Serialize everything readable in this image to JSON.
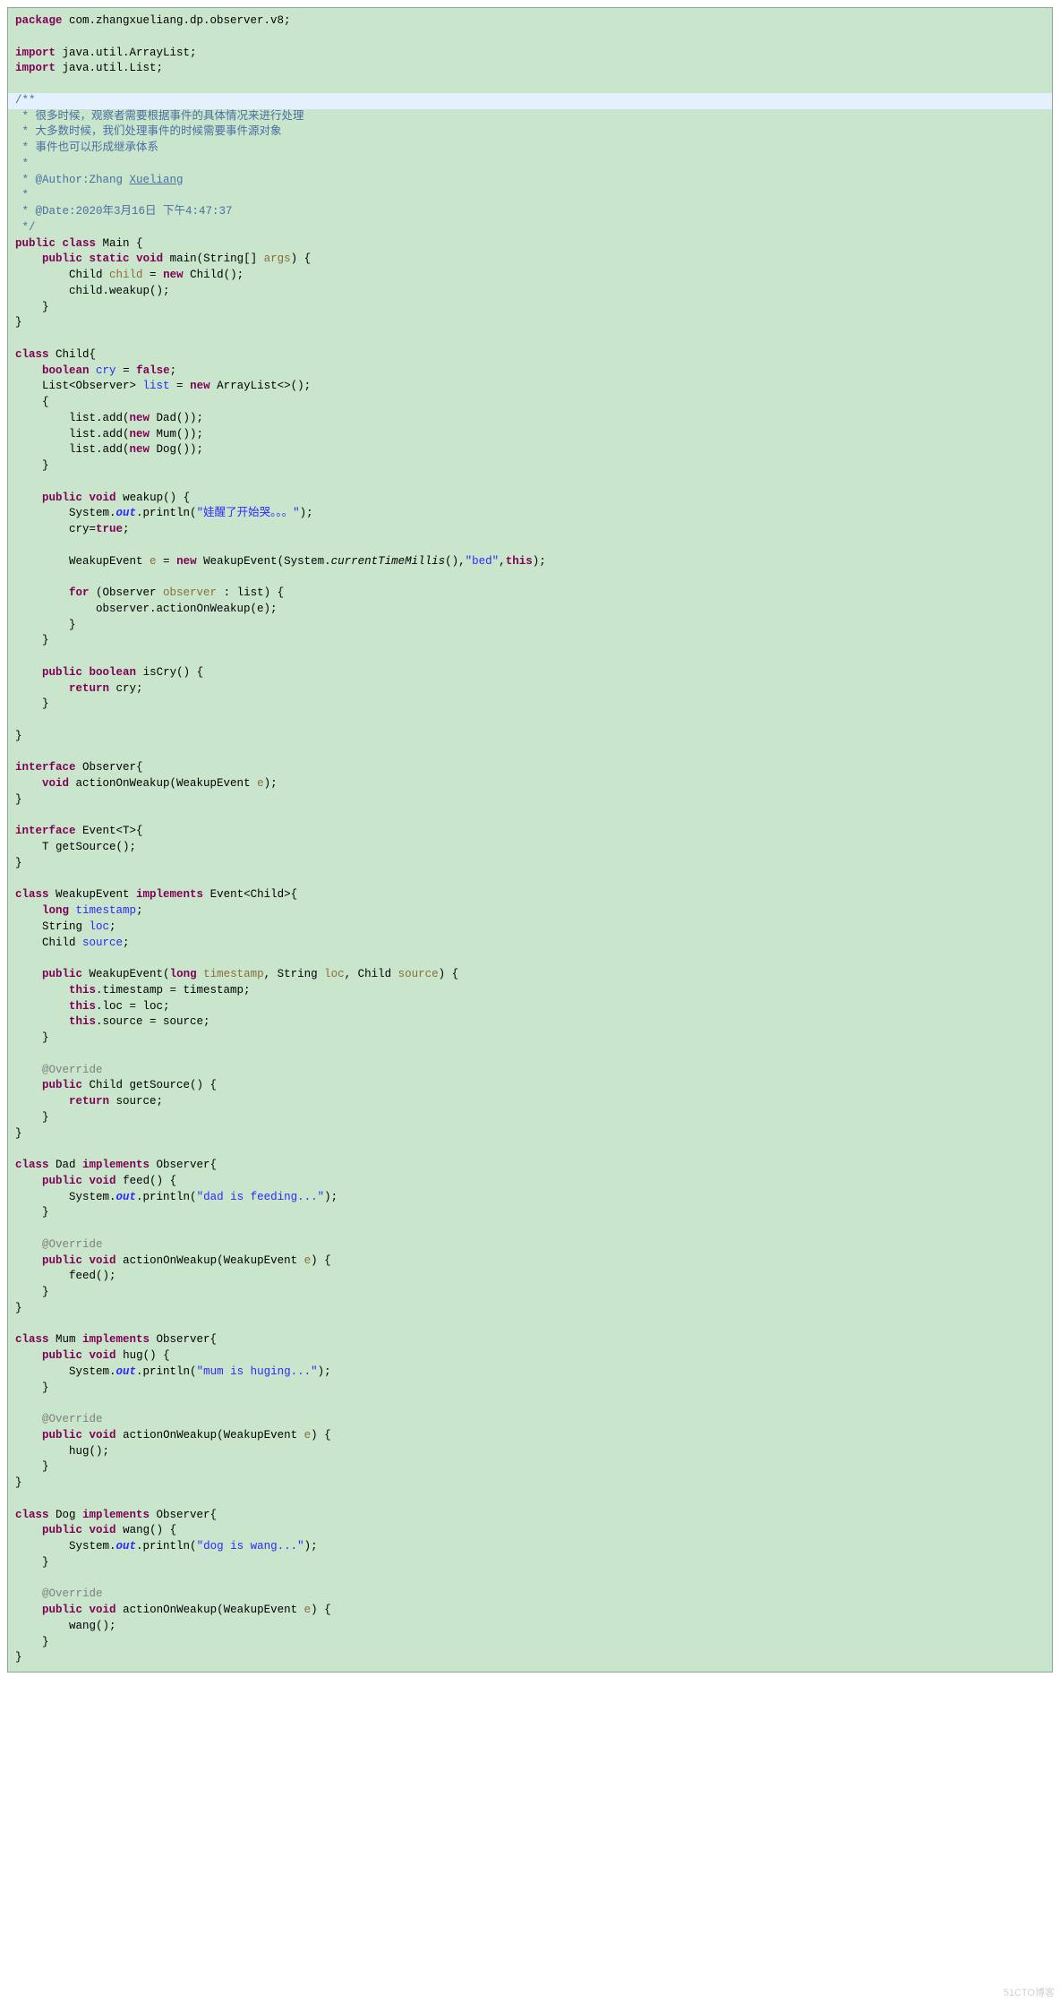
{
  "code": {
    "pkg_kw": "package",
    "pkg_name": " com.zhangxueliang.dp.observer.v8;",
    "import_kw": "import",
    "import1": " java.util.ArrayList;",
    "import2": " java.util.List;",
    "jdoc_open": "/**",
    "jdoc_l1": " * 很多时候，观察者需要根据事件的具体情况来进行处理",
    "jdoc_l2": " * 大多数时候，我们处理事件的时候需要事件源对象",
    "jdoc_l3": " * 事件也可以形成继承体系",
    "jdoc_l4": " * ",
    "jdoc_l5a": " * @Author:Zhang ",
    "jdoc_l5b": "Xueliang",
    "jdoc_l6": " * ",
    "jdoc_l7": " * @Date:2020年3月16日 下午4:47:37",
    "jdoc_close": " */",
    "public_kw": "public",
    "class_kw": "class",
    "static_kw": "static",
    "void_kw": "void",
    "new_kw": "new",
    "boolean_kw": "boolean",
    "false_kw": "false",
    "true_kw": "true",
    "this_kw": "this",
    "return_kw": "return",
    "for_kw": "for",
    "implements_kw": "implements",
    "interface_kw": "interface",
    "long_kw": "long",
    "main_class": " Main {",
    "main_sig1": " main(String[] ",
    "args": "args",
    "main_sig2": ") {",
    "child_decl1": "        Child ",
    "child_var": "child",
    "child_decl2": " = ",
    "child_decl3": " Child();",
    "child_weakup": "        child.weakup();",
    "brace_close1": "    }",
    "brace_close0": "}",
    "child_class": " Child{",
    "cry_field": "cry",
    "cry_decl_eq": " = ",
    "cry_semi": ";",
    "list_decl1": "    List<Observer> ",
    "list_field": "list",
    "list_decl2": " = ",
    "list_decl3": " ArrayList<>();",
    "init_open": "    {",
    "list_add1a": "        list.add(",
    "list_add1b": " Dad());",
    "list_add2b": " Mum());",
    "list_add3b": " Dog());",
    "weakup_sig": " weakup() {",
    "sysout1a": "        System.",
    "out": "out",
    "sysout1b": ".println(",
    "str_cry": "\"娃醒了开始哭。。。\"",
    "sysout1c": ");",
    "cry_assign1": "        cry=",
    "weakup_ev1": "        WeakupEvent ",
    "e_var": "e",
    "weakup_ev2": " = ",
    "weakup_ev3": " WeakupEvent(System.",
    "ctm": "currentTimeMillis",
    "weakup_ev4": "(),",
    "str_bed": "\"bed\"",
    "weakup_ev5": ",",
    "weakup_ev6": ");",
    "for_sig1": " (Observer ",
    "observer_var": "observer",
    "for_sig2": " : list) {",
    "obs_call": "            observer.actionOnWeakup(e);",
    "iscry_sig": " isCry() {",
    "return_cry": " cry;",
    "obs_iface": " Observer{",
    "action_sig1": " actionOnWeakup(WeakupEvent ",
    "action_sig2": ");",
    "event_iface": " Event<T>{",
    "getsource_sig": "    T getSource();",
    "weakupevent_cls": " WeakupEvent ",
    "weakupevent_impl": " Event<Child>{",
    "ts_field": "timestamp",
    "ts_decl_semi": ";",
    "loc_decl": "    String ",
    "loc_field": "loc",
    "src_decl": "    Child ",
    "src_field": "source",
    "ctor_sig1": " WeakupEvent(",
    "ctor_sig2": " ",
    "ts_param": "timestamp",
    "ctor_sig3": ", String ",
    "loc_param": "loc",
    "ctor_sig4": ", Child ",
    "src_param": "source",
    "ctor_sig5": ") {",
    "this_ts1": ".timestamp = timestamp;",
    "this_loc1": ".loc = loc;",
    "this_src1": ".source = source;",
    "override": "@Override",
    "getsrc_sig": " Child getSource() {",
    "return_src": " source;",
    "dad_cls": " Dad ",
    "dad_impl": " Observer{",
    "feed_sig": " feed() {",
    "str_dad": "\"dad is feeding...\"",
    "action_sig_body1": " actionOnWeakup(WeakupEvent ",
    "action_sig_body2": ") {",
    "feed_call": "        feed();",
    "mum_cls": " Mum ",
    "hug_sig": " hug() {",
    "str_mum": "\"mum is huging...\"",
    "hug_call": "        hug();",
    "dog_cls": " Dog ",
    "wang_sig": " wang() {",
    "str_dog": "\"dog is wang...\"",
    "wang_call": "        wang();"
  },
  "watermark": "51CTO博客"
}
